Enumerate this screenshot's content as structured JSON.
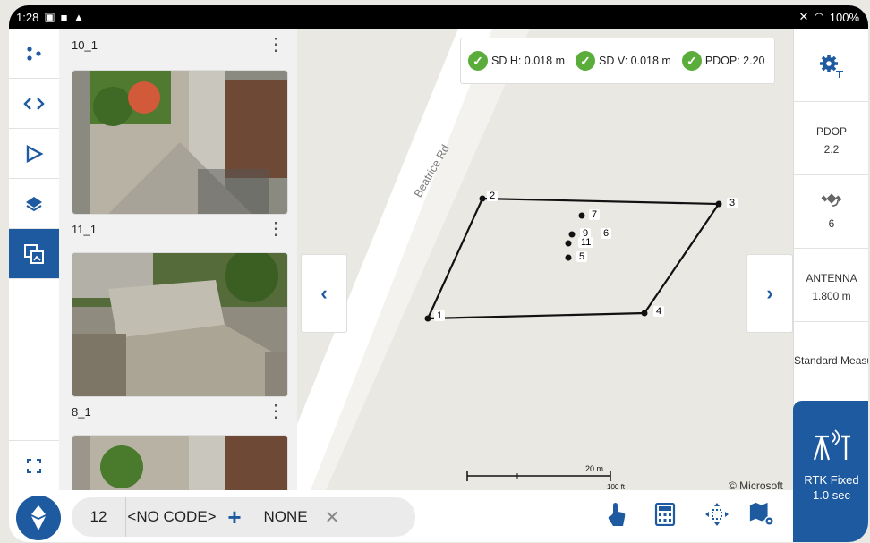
{
  "status_bar": {
    "time": "1:28",
    "battery": "100%"
  },
  "rail": {
    "items": [
      {
        "name": "dots-icon",
        "glyph": "⁘"
      },
      {
        "name": "code-icon",
        "glyph": "‹›"
      },
      {
        "name": "route-icon",
        "glyph": "▷"
      },
      {
        "name": "layers-icon",
        "glyph": "◆"
      },
      {
        "name": "media-icon",
        "glyph": "▣"
      }
    ],
    "expand_glyph": "⛶"
  },
  "photos": [
    {
      "label": "10_1"
    },
    {
      "label": "11_1"
    },
    {
      "label": "8_1"
    }
  ],
  "map": {
    "quality": [
      {
        "label": "SD H: 0.018 m"
      },
      {
        "label": "SD V: 0.018 m"
      },
      {
        "label": "PDOP: 2.20"
      }
    ],
    "road_label": "Beatrice Rd",
    "points": [
      {
        "id": "1"
      },
      {
        "id": "2"
      },
      {
        "id": "3"
      },
      {
        "id": "4"
      },
      {
        "id": "5"
      },
      {
        "id": "6"
      },
      {
        "id": "7"
      },
      {
        "id": "9"
      },
      {
        "id": "11"
      }
    ],
    "scale_label": "20 m",
    "scale_label_ft": "100 ft",
    "attribution": "© Microsoft"
  },
  "right_panel": {
    "pdop_title": "PDOP",
    "pdop_value": "2.2",
    "satellites": "6",
    "antenna_title": "ANTENNA",
    "antenna_value": "1.800 m",
    "method": "Standard Measur",
    "rtk_status": "RTK Fixed",
    "rtk_interval": "1.0 sec"
  },
  "bottom": {
    "point_number": "12",
    "code": "<NO CODE>",
    "plus": "+",
    "layer": "NONE",
    "clear": "✕"
  }
}
